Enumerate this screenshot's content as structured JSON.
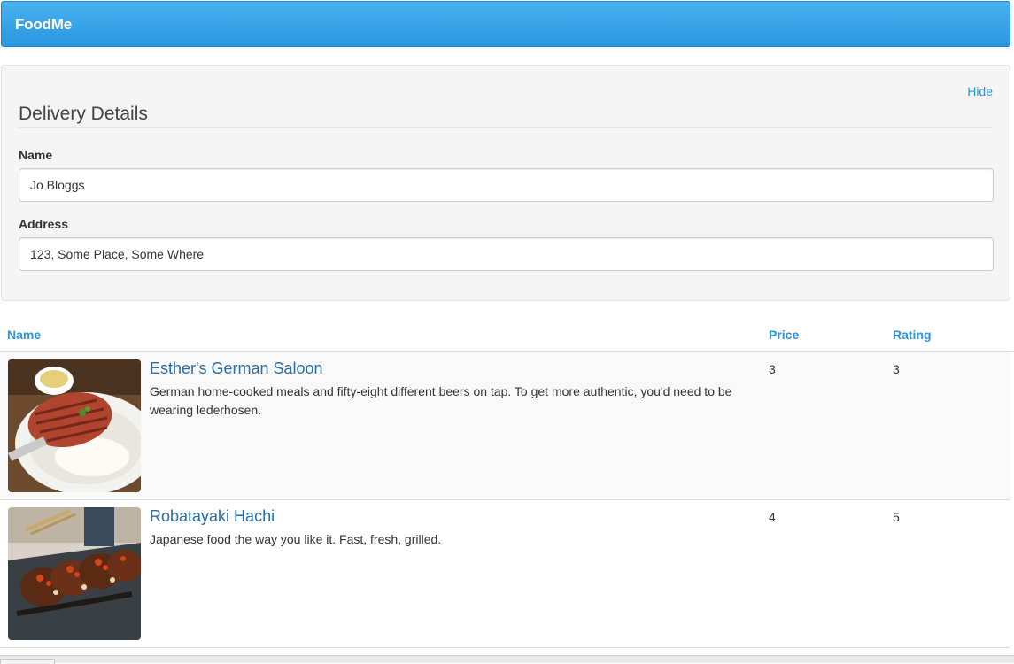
{
  "navbar": {
    "brand": "FoodMe",
    "bg_color": "#2a97e2"
  },
  "delivery": {
    "hide_label": "Hide",
    "title": "Delivery Details",
    "name_label": "Name",
    "name_value": "Jo Bloggs",
    "address_label": "Address",
    "address_value": "123, Some Place, Some Where"
  },
  "table": {
    "headers": {
      "name": "Name",
      "price": "Price",
      "rating": "Rating"
    },
    "rows": [
      {
        "name": "Esther's German Saloon",
        "description": "German home-cooked meals and fifty-eight different beers on tap. To get more authentic, you'd need to be wearing lederhosen.",
        "price": "3",
        "rating": "3",
        "image": "grilled-steak-photo"
      },
      {
        "name": "Robatayaki Hachi",
        "description": "Japanese food the way you like it. Fast, fresh, grilled.",
        "price": "4",
        "rating": "5",
        "image": "sushi-roll-photo"
      }
    ]
  },
  "colors": {
    "accent": "#2a97e2",
    "restaurant_link": "#2d6ea1"
  }
}
